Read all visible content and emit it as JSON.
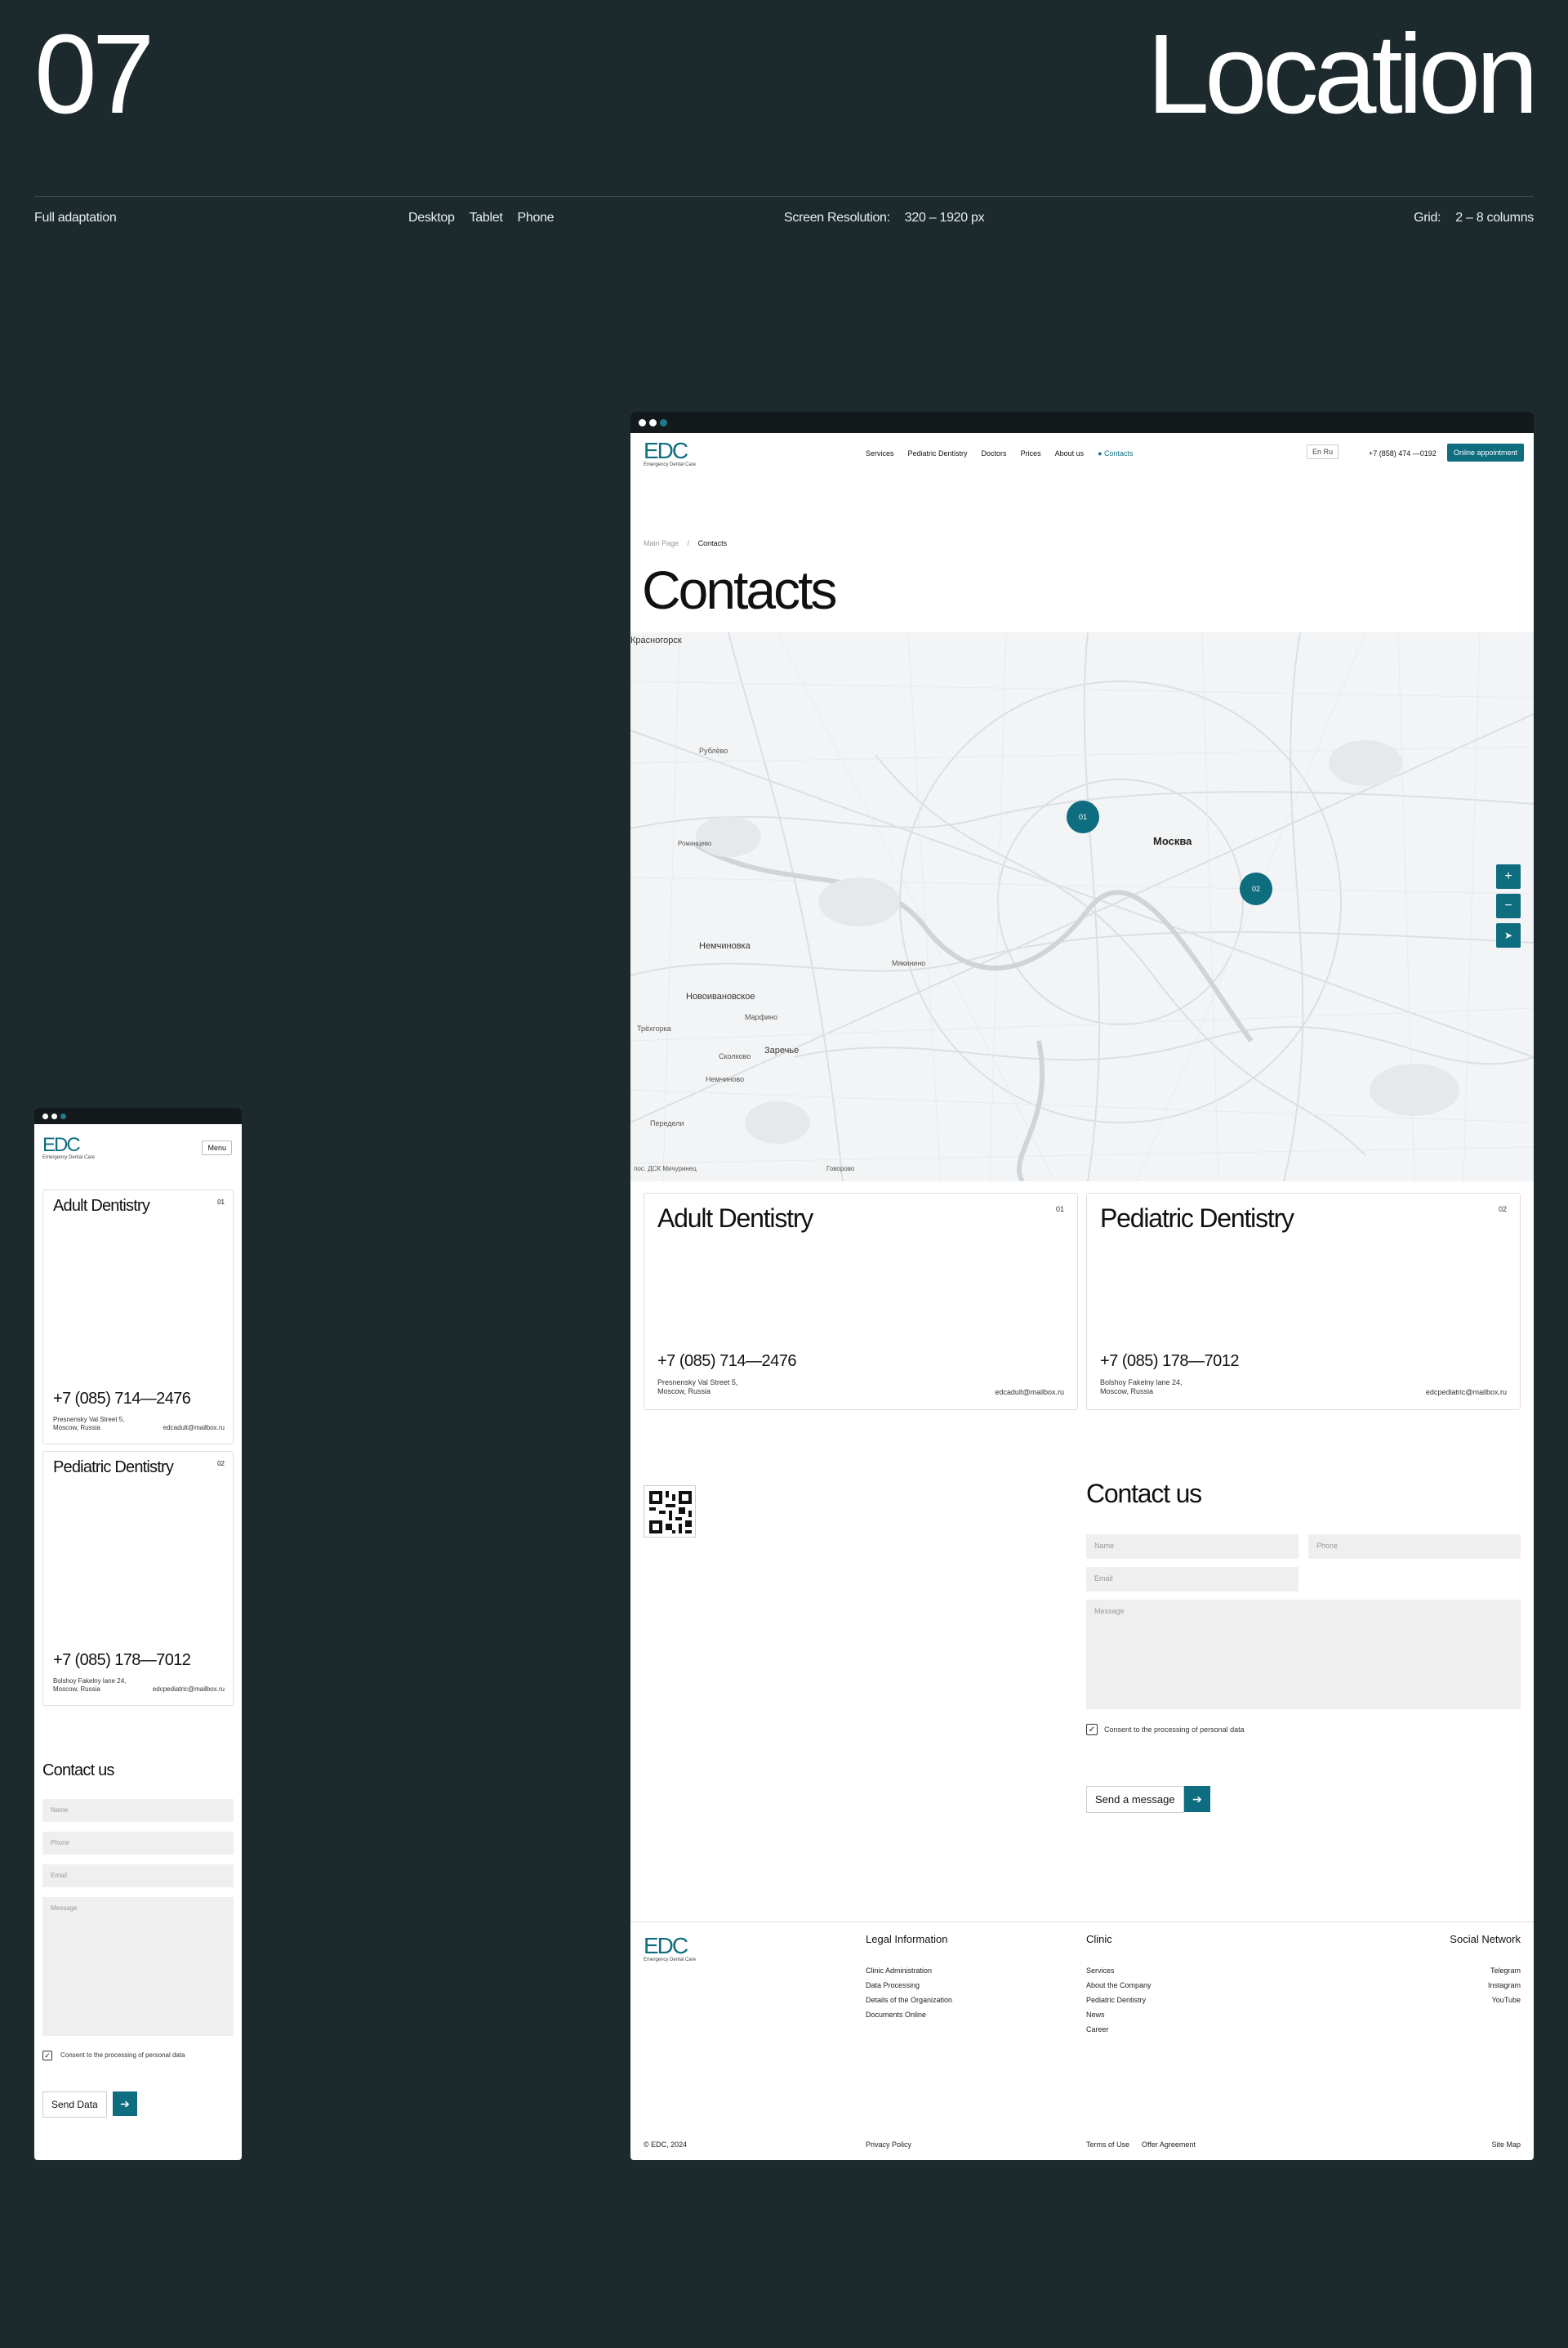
{
  "presentation": {
    "number": "07",
    "title": "Location",
    "adaptation": "Full adaptation",
    "devices": [
      "Desktop",
      "Tablet",
      "Phone"
    ],
    "resolution_label": "Screen Resolution:",
    "resolution_value": "320 – 1920 px",
    "grid_label": "Grid:",
    "grid_value": "2 – 8 columns"
  },
  "brand": {
    "logo": "EDC",
    "tagline": "Emergency Dental Care"
  },
  "nav": {
    "items": [
      "Services",
      "Pediatric Dentistry",
      "Doctors",
      "Prices",
      "About us",
      "Contacts"
    ],
    "lang": "En  Ru",
    "phone": "+7 (858) 474 —0192",
    "cta": "Online appointment"
  },
  "breadcrumb": {
    "home": "Main Page",
    "sep": "/",
    "current": "Contacts"
  },
  "page_title": "Contacts",
  "map": {
    "city_label": "Москва",
    "labels": [
      "Красногорск",
      "Немчиновка",
      "Новоивановское",
      "Заречье",
      "Трёхгорка",
      "Мякинино",
      "Рублёво",
      "Романцево",
      "Марфино",
      "Сколково",
      "Немчиново",
      "Передели",
      "пос. ДСК Мичуринец",
      "Говорово"
    ],
    "pins": [
      "01",
      "02"
    ],
    "controls": [
      "+",
      "−",
      "➤"
    ]
  },
  "clinics": [
    {
      "title": "Adult Dentistry",
      "num": "01",
      "phone": "+7 (085) 714—2476",
      "addr1": "Presnensky Val Street 5,",
      "addr2": "Moscow, Russia",
      "email": "edcadult@mailbox.ru"
    },
    {
      "title": "Pediatric Dentistry",
      "num": "02",
      "phone": "+7 (085) 178—7012",
      "addr1": "Bolshoy Fakelny lane 24,",
      "addr2": "Moscow, Russia",
      "email": "edcpediatric@mailbox.ru"
    }
  ],
  "contact": {
    "title": "Contact us",
    "name_ph": "Name",
    "phone_ph": "Phone",
    "email_ph": "Email",
    "message_ph": "Message",
    "consent": "Consent to the processing of personal data",
    "send": "Send a message",
    "send_mobile": "Send Data"
  },
  "footer": {
    "legal": {
      "title": "Legal Information",
      "items": [
        "Clinic Administration",
        "Data Processing",
        "Details of the Organization",
        "Documents Online"
      ]
    },
    "clinic": {
      "title": "Clinic",
      "items": [
        "Services",
        "About the Company",
        "Pediatric Dentistry",
        "News",
        "Career"
      ]
    },
    "social": {
      "title": "Social Network",
      "items": [
        "Telegram",
        "Instagram",
        "YouTube"
      ]
    },
    "copyright": "© EDC, 2024",
    "privacy": "Privacy Policy",
    "terms": "Terms of Use",
    "offer": "Offer Agreement",
    "sitemap": "Site Map"
  },
  "mobile": {
    "menu": "Menu"
  },
  "colors": {
    "accent": "#0f6d80",
    "background": "#1c2a2e"
  }
}
